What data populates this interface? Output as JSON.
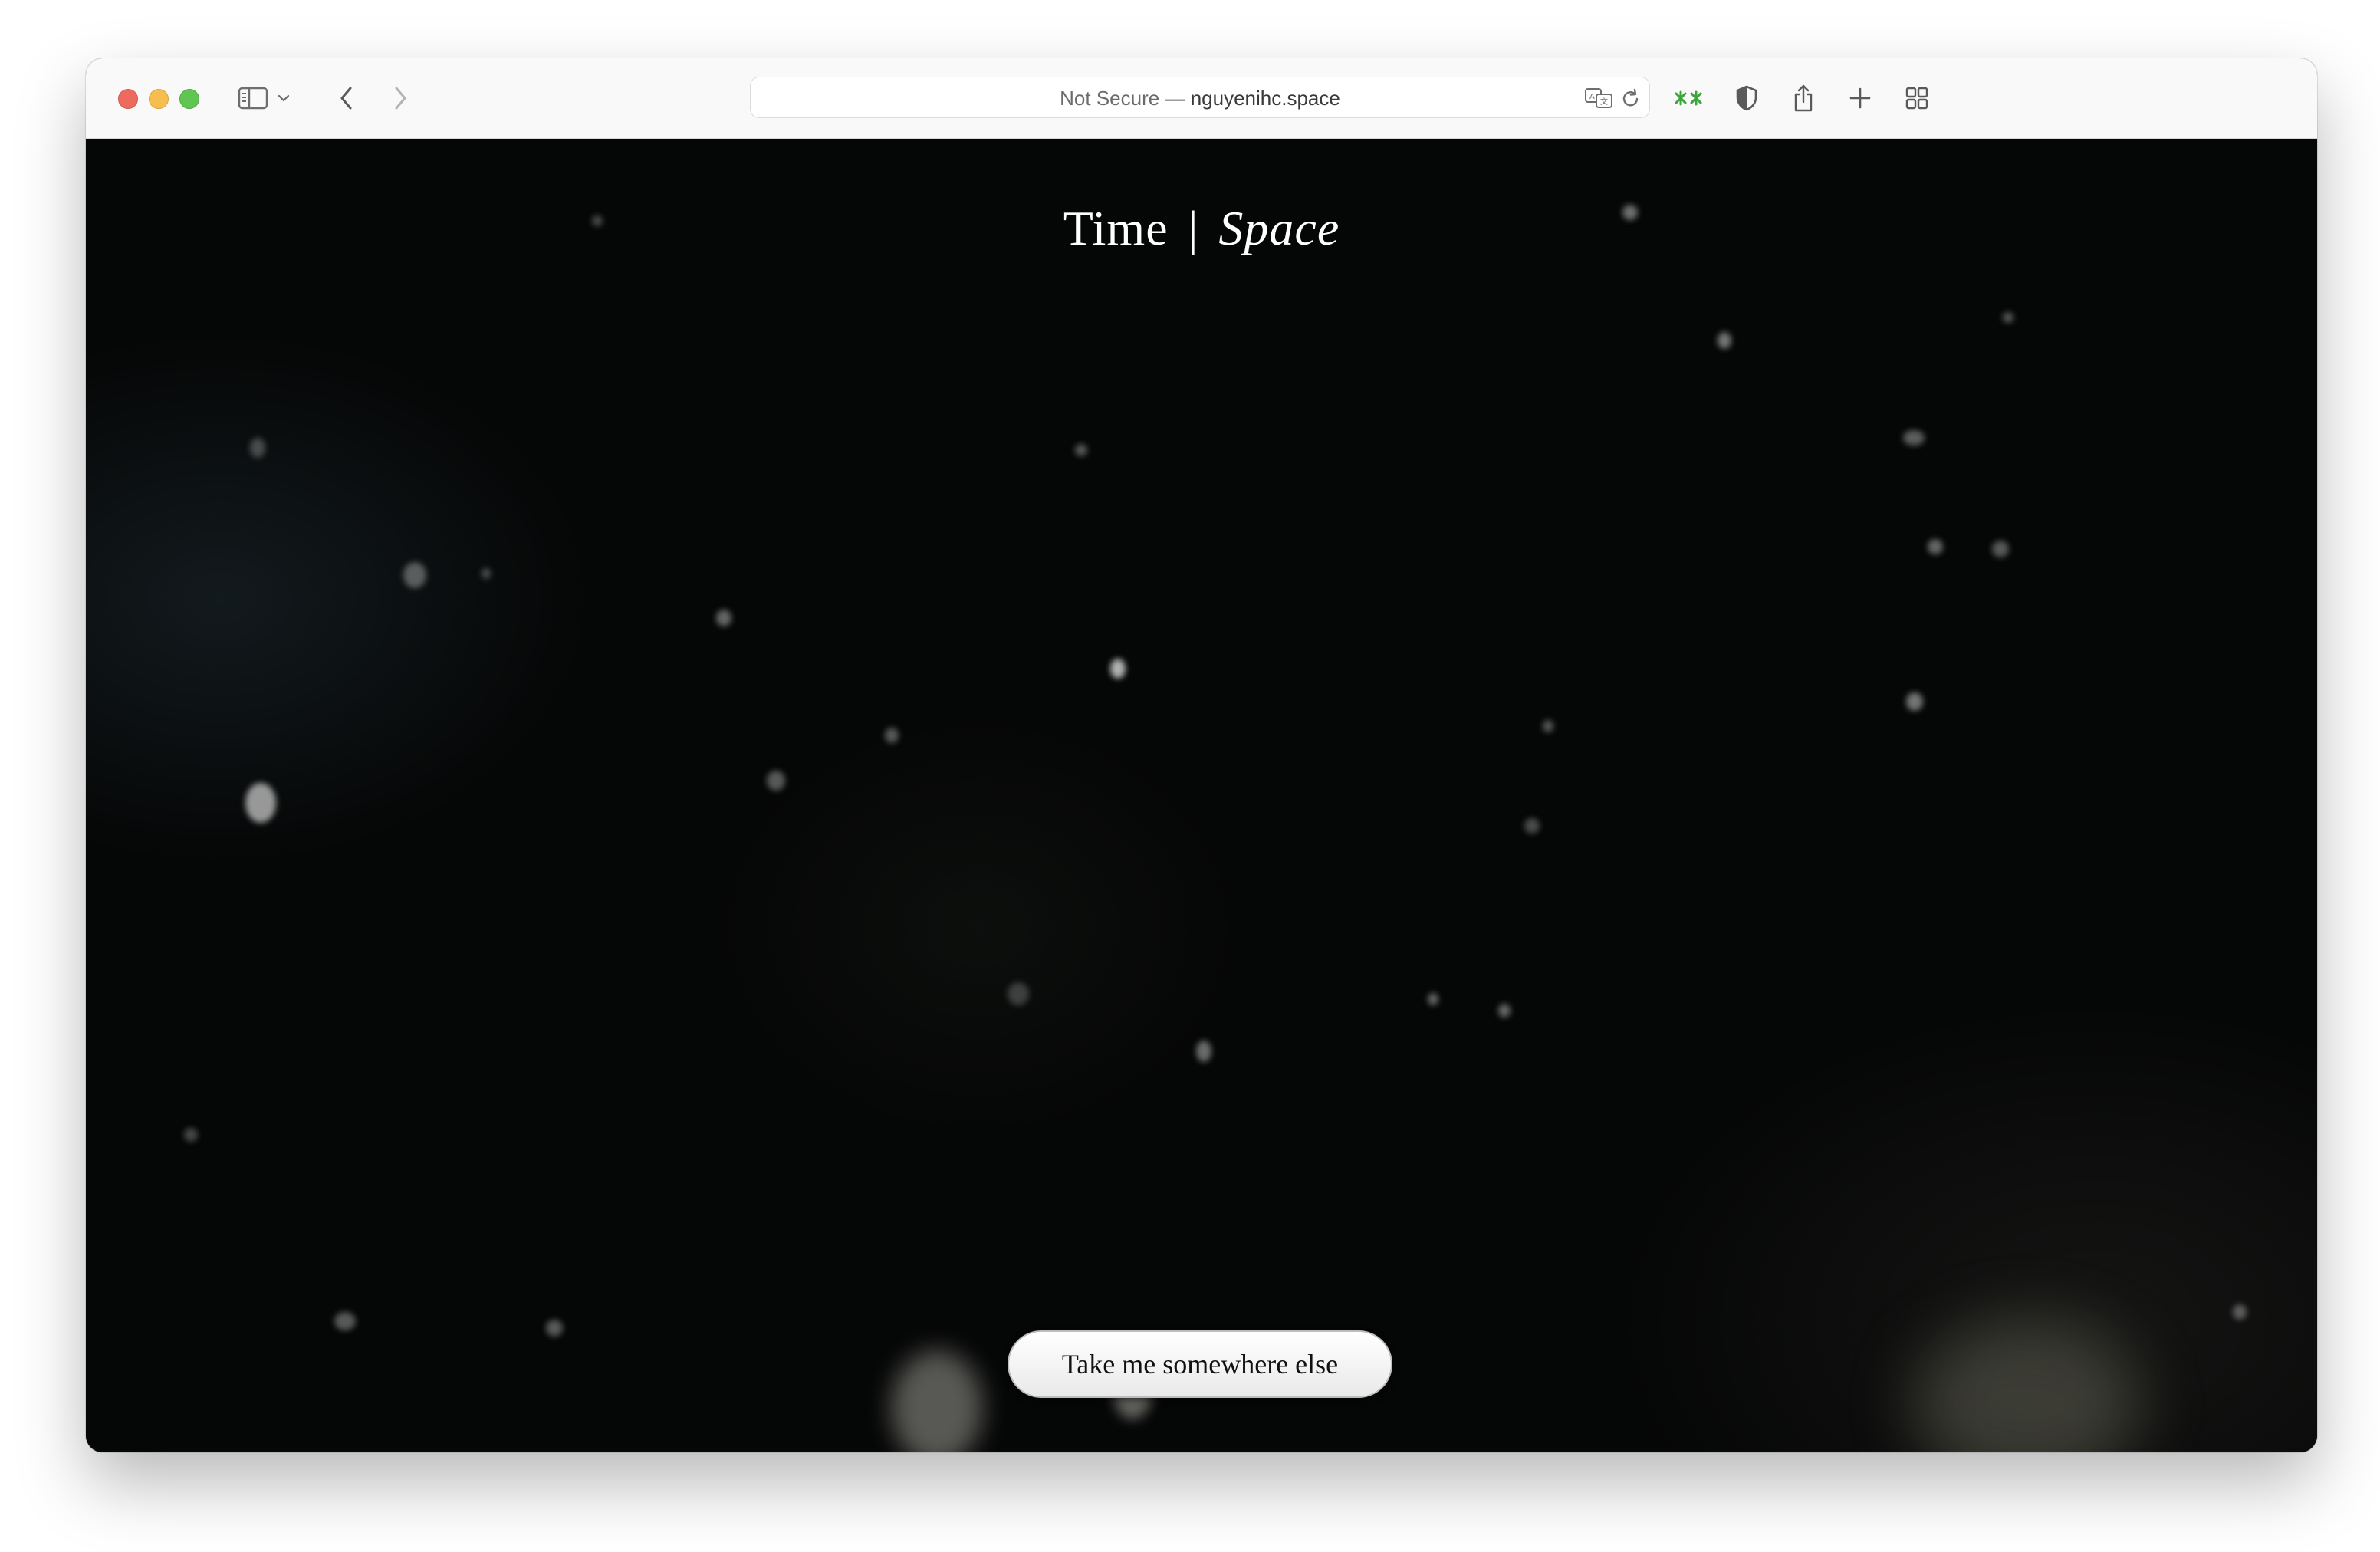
{
  "browser": {
    "url_security": "Not Secure",
    "url_separator": "—",
    "url_domain": "nguyenihc.space"
  },
  "icons": {
    "window_controls": [
      "close",
      "minimize",
      "maximize"
    ],
    "toolbar_left": [
      "sidebar-icon",
      "chevron-down-icon",
      "back-icon",
      "forward-icon"
    ],
    "url_bar": [
      "translate-icon",
      "reload-icon"
    ],
    "toolbar_right": [
      "extension-icon",
      "privacy-shield-icon",
      "share-icon",
      "new-tab-icon",
      "tab-overview-icon"
    ]
  },
  "colors": {
    "close": "#ed6a5e",
    "minimize": "#f5be4f",
    "maximize": "#61c554",
    "extension": "#3aa63a",
    "page_background": "#050606"
  },
  "page": {
    "title_time": "Time",
    "title_separator": "|",
    "title_space": "Space",
    "cta_label": "Take me somewhere else"
  }
}
